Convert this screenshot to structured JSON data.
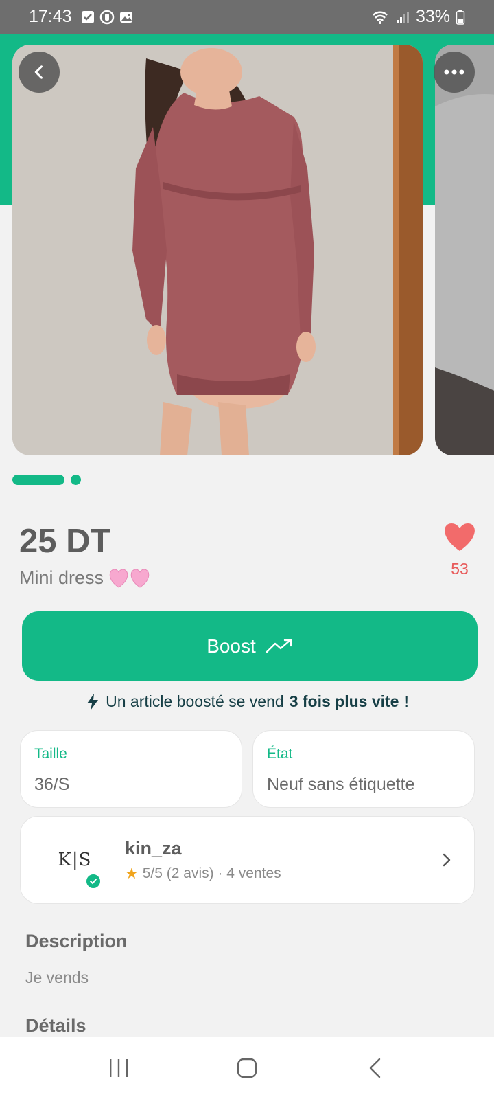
{
  "status_bar": {
    "time": "17:43",
    "battery": "33%",
    "icons": [
      "checkbox-notification-icon",
      "sync-icon",
      "gallery-icon",
      "wifi-icon",
      "signal-icon",
      "battery-icon"
    ]
  },
  "carousel": {
    "images": [
      "product-photo-mini-dress",
      "product-photo-2"
    ],
    "active_index": 0,
    "back_icon": "chevron-left-icon",
    "more_icon": "more-dots-icon"
  },
  "product": {
    "price": "25 DT",
    "title": "Mini dress",
    "title_emoji": "heart-emoji",
    "likes": "53"
  },
  "boost": {
    "label": "Boost",
    "icon": "trending-up-icon",
    "note_prefix": "Un article boosté se vend",
    "note_bold": "3 fois plus vite",
    "note_suffix": "!"
  },
  "attributes": {
    "size_label": "Taille",
    "size_value": "36/S",
    "state_label": "État",
    "state_value": "Neuf sans étiquette"
  },
  "seller": {
    "avatar_text": "K|S",
    "name": "kin_za",
    "rating": "5/5 (2 avis) · 4 ventes"
  },
  "description": {
    "title": "Description",
    "text": "Je vends"
  },
  "details": {
    "title": "Détails"
  },
  "nav": {
    "icons": [
      "recent-apps-icon",
      "home-icon",
      "back-icon"
    ]
  },
  "colors": {
    "accent": "#13b987",
    "like": "#f26b6b",
    "status_bar": "#6e6e6e",
    "dress": "#a45a5e"
  }
}
